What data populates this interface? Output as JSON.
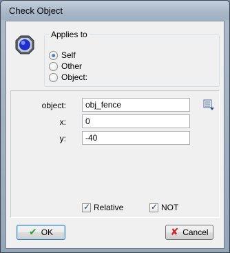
{
  "window": {
    "title": "Check Object"
  },
  "applies_to": {
    "legend": "Applies to",
    "options": [
      {
        "label": "Self",
        "checked": true
      },
      {
        "label": "Other",
        "checked": false
      },
      {
        "label": "Object:",
        "checked": false
      }
    ]
  },
  "fields": {
    "object": {
      "label": "object:",
      "value": "obj_fence"
    },
    "x": {
      "label": "x:",
      "value": "0"
    },
    "y": {
      "label": "y:",
      "value": "-40"
    }
  },
  "options": {
    "relative": {
      "label": "Relative",
      "checked": true
    },
    "not": {
      "label": "NOT",
      "checked": true
    }
  },
  "buttons": {
    "ok": "OK",
    "cancel": "Cancel"
  },
  "icons": {
    "action": "blue-octagon-icon",
    "object_picker": "object-menu-icon",
    "ok": "green-check-icon",
    "cancel": "red-x-icon"
  },
  "colors": {
    "ok_check": "#2e9d2e",
    "cancel_x": "#d42020",
    "gem_blue": "#1f2fcc"
  }
}
